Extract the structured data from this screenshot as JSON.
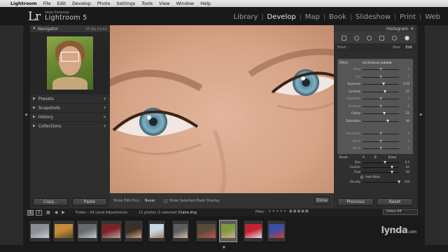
{
  "menubar": {
    "items": [
      "Lightroom",
      "File",
      "Edit",
      "Develop",
      "Photo",
      "Settings",
      "Tools",
      "View",
      "Window",
      "Help"
    ]
  },
  "identity": {
    "logo": "Lr",
    "sub": "Adobe Photoshop",
    "name": "Lightroom 5"
  },
  "modules": [
    "Library",
    "Develop",
    "Map",
    "Book",
    "Slideshow",
    "Print",
    "Web"
  ],
  "active_module": "Develop",
  "navigator": {
    "title": "Navigator",
    "zoom": "FIT  FILL  1:1  4:1"
  },
  "left_panels": [
    {
      "label": "Presets",
      "right": "+"
    },
    {
      "label": "Snapshots",
      "right": "+"
    },
    {
      "label": "History",
      "right": "×"
    },
    {
      "label": "Collections",
      "right": "+"
    }
  ],
  "left_buttons": {
    "copy": "Copy...",
    "paste": "Paste"
  },
  "toolbar": {
    "show_edit_pins_label": "Show Edit Pins :",
    "show_edit_pins_value": "Never",
    "overlay_label": "Show Selected Mask Overlay",
    "done": "Done"
  },
  "right_panel": {
    "histogram_title": "Histogram",
    "mask_label": "Mask :",
    "mask_new": "New",
    "mask_edit": "Edit",
    "effect_label": "Effect :",
    "effect_value": "Iris Enhance (edited)",
    "color_label": "Color",
    "brush": {
      "label": "Brush :",
      "a": "A",
      "b": "B",
      "erase": "Erase",
      "size_label": "Size",
      "size": "6.4",
      "feather_label": "Feather",
      "feather": "81",
      "flow_label": "Flow",
      "flow": "80",
      "automask_label": "Auto Mask",
      "density_label": "Density",
      "density": "100"
    },
    "previous": "Previous",
    "reset": "Reset"
  },
  "adjustments": [
    {
      "label": "Temp",
      "value": "0",
      "pos": 0.5,
      "dim": true
    },
    {
      "label": "Tint",
      "value": "0",
      "pos": 0.5,
      "dim": true
    },
    {
      "label": "Exposure",
      "value": "0.53",
      "pos": 0.58,
      "dim": false
    },
    {
      "label": "Contrast",
      "value": "27",
      "pos": 0.63,
      "dim": false
    },
    {
      "label": "Highlights",
      "value": "0",
      "pos": 0.5,
      "dim": true
    },
    {
      "label": "Shadows",
      "value": "0",
      "pos": 0.5,
      "dim": true
    },
    {
      "label": "Clarity",
      "value": "21",
      "pos": 0.6,
      "dim": false
    },
    {
      "label": "Saturation",
      "value": "40",
      "pos": 0.7,
      "dim": false
    },
    {
      "label": "Sharpness",
      "value": "0",
      "pos": 0.5,
      "dim": true
    },
    {
      "label": "Noise",
      "value": "0",
      "pos": 0.5,
      "dim": true
    },
    {
      "label": "Moiré",
      "value": "0",
      "pos": 0.5,
      "dim": true
    },
    {
      "label": "Defringe",
      "value": "0",
      "pos": 0.5,
      "dim": true
    }
  ],
  "filmstrip_bar": {
    "page1": "1",
    "page2": "2",
    "folder": "Folder : 04 Local Adjustments",
    "info": "11 photos /1 selected /",
    "filename": "Claire.dng",
    "filter_label": "Filter :",
    "filters_off": "Filters Off"
  },
  "thumbnails": [
    {
      "colors": [
        "#8a8f96",
        "#c9cdd2"
      ]
    },
    {
      "colors": [
        "#c58a3a",
        "#5a4b2a"
      ]
    },
    {
      "colors": [
        "#666a6e",
        "#c8c8c8"
      ]
    },
    {
      "colors": [
        "#7a2428",
        "#c0a090"
      ]
    },
    {
      "colors": [
        "#3a3028",
        "#d2a98a"
      ]
    },
    {
      "colors": [
        "#c9d6e3",
        "#a67e5c"
      ]
    },
    {
      "colors": [
        "#5a5e62",
        "#d9b89a"
      ]
    },
    {
      "colors": [
        "#5a4a3a",
        "#c0584a"
      ]
    },
    {
      "colors": [
        "#7d9a40",
        "#d6a888"
      ]
    },
    {
      "colors": [
        "#c42030",
        "#e4e0e0"
      ]
    },
    {
      "colors": [
        "#3a4fa0",
        "#d43a3a"
      ]
    }
  ],
  "watermark": {
    "main": "lynda",
    "sub": ".com"
  }
}
